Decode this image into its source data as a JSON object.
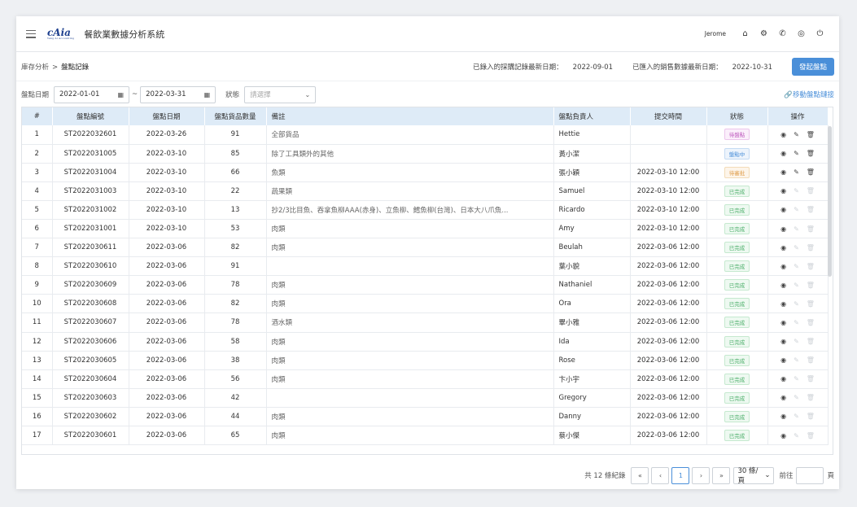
{
  "header": {
    "logo_text": "cAia",
    "logo_sub": "Yang Ai Accounting",
    "app_title": "餐飲業數據分析系統",
    "user": "Jerome",
    "icons": [
      "home-icon",
      "gear-icon",
      "phone-icon",
      "globe-icon",
      "power-icon"
    ]
  },
  "breadcrumb": {
    "parent": "庫存分析",
    "separator": ">",
    "current": "盤點記錄"
  },
  "info": {
    "purchase_label": "已錄入的採購記錄最新日期：",
    "purchase_date": "2022-09-01",
    "sales_label": "已匯入的銷售數據最新日期：",
    "sales_date": "2022-10-31",
    "start_button": "發起盤點"
  },
  "filter": {
    "date_label": "盤點日期",
    "date_from": "2022-01-01",
    "tilde": "~",
    "date_to": "2022-03-31",
    "status_label": "狀態",
    "status_placeholder": "請選擇",
    "move_link": "移動盤點鏈接"
  },
  "table": {
    "columns": [
      "#",
      "盤點編號",
      "盤點日期",
      "盤點貨品數量",
      "備註",
      "盤點負責人",
      "提交時間",
      "狀態",
      "操作"
    ],
    "rows": [
      {
        "no": "1",
        "id": "ST2022032601",
        "date": "2022-03-26",
        "qty": "91",
        "note": "全部貨品",
        "owner": "Hettie",
        "submitted": "",
        "status": "待盤點",
        "status_kind": "wait"
      },
      {
        "no": "2",
        "id": "ST2022031005",
        "date": "2022-03-10",
        "qty": "85",
        "note": "除了工具類外的其他",
        "owner": "黃小潔",
        "submitted": "",
        "status": "盤點中",
        "status_kind": "progress"
      },
      {
        "no": "3",
        "id": "ST2022031004",
        "date": "2022-03-10",
        "qty": "66",
        "note": "魚類",
        "owner": "張小穎",
        "submitted": "2022-03-10  12:00",
        "status": "待審批",
        "status_kind": "check"
      },
      {
        "no": "4",
        "id": "ST2022031003",
        "date": "2022-03-10",
        "qty": "22",
        "note": "蔬果類",
        "owner": "Samuel",
        "submitted": "2022-03-10  12:00",
        "status": "已完成",
        "status_kind": "done"
      },
      {
        "no": "5",
        "id": "ST2022031002",
        "date": "2022-03-10",
        "qty": "13",
        "note": "抄2/3比目魚、吞拿魚柳AAA(赤身)、立魚柳、鱈魚柳(台灣)、日本大八爪魚...",
        "owner": "Ricardo",
        "submitted": "2022-03-10  12:00",
        "status": "已完成",
        "status_kind": "done"
      },
      {
        "no": "6",
        "id": "ST2022031001",
        "date": "2022-03-10",
        "qty": "53",
        "note": "肉類",
        "owner": "Amy",
        "submitted": "2022-03-10  12:00",
        "status": "已完成",
        "status_kind": "done"
      },
      {
        "no": "7",
        "id": "ST2022030611",
        "date": "2022-03-06",
        "qty": "82",
        "note": "肉類",
        "owner": "Beulah",
        "submitted": "2022-03-06  12:00",
        "status": "已完成",
        "status_kind": "done"
      },
      {
        "no": "8",
        "id": "ST2022030610",
        "date": "2022-03-06",
        "qty": "91",
        "note": "",
        "owner": "葉小貌",
        "submitted": "2022-03-06  12:00",
        "status": "已完成",
        "status_kind": "done"
      },
      {
        "no": "9",
        "id": "ST2022030609",
        "date": "2022-03-06",
        "qty": "78",
        "note": "肉類",
        "owner": "Nathaniel",
        "submitted": "2022-03-06  12:00",
        "status": "已完成",
        "status_kind": "done"
      },
      {
        "no": "10",
        "id": "ST2022030608",
        "date": "2022-03-06",
        "qty": "82",
        "note": "肉類",
        "owner": "Ora",
        "submitted": "2022-03-06  12:00",
        "status": "已完成",
        "status_kind": "done"
      },
      {
        "no": "11",
        "id": "ST2022030607",
        "date": "2022-03-06",
        "qty": "78",
        "note": "酒水類",
        "owner": "畢小雅",
        "submitted": "2022-03-06  12:00",
        "status": "已完成",
        "status_kind": "done"
      },
      {
        "no": "12",
        "id": "ST2022030606",
        "date": "2022-03-06",
        "qty": "58",
        "note": "肉類",
        "owner": "Ida",
        "submitted": "2022-03-06  12:00",
        "status": "已完成",
        "status_kind": "done"
      },
      {
        "no": "13",
        "id": "ST2022030605",
        "date": "2022-03-06",
        "qty": "38",
        "note": "肉類",
        "owner": "Rose",
        "submitted": "2022-03-06  12:00",
        "status": "已完成",
        "status_kind": "done"
      },
      {
        "no": "14",
        "id": "ST2022030604",
        "date": "2022-03-06",
        "qty": "56",
        "note": "肉類",
        "owner": "卞小宇",
        "submitted": "2022-03-06  12:00",
        "status": "已完成",
        "status_kind": "done"
      },
      {
        "no": "15",
        "id": "ST2022030603",
        "date": "2022-03-06",
        "qty": "42",
        "note": "",
        "owner": "Gregory",
        "submitted": "2022-03-06  12:00",
        "status": "已完成",
        "status_kind": "done"
      },
      {
        "no": "16",
        "id": "ST2022030602",
        "date": "2022-03-06",
        "qty": "44",
        "note": "肉類",
        "owner": "Danny",
        "submitted": "2022-03-06  12:00",
        "status": "已完成",
        "status_kind": "done"
      },
      {
        "no": "17",
        "id": "ST2022030601",
        "date": "2022-03-06",
        "qty": "65",
        "note": "肉類",
        "owner": "蔡小傑",
        "submitted": "2022-03-06  12:00",
        "status": "已完成",
        "status_kind": "done"
      }
    ]
  },
  "pager": {
    "total": "共 12 條紀錄",
    "current_page": "1",
    "page_size": "30 條/頁",
    "goto_label": "前往",
    "page_unit": "頁"
  },
  "colors": {
    "accent": "#4a8fd9",
    "header_bg": "#deebf7",
    "done": "#4caf6a",
    "wait": "#c060c0",
    "check": "#e0a050"
  }
}
